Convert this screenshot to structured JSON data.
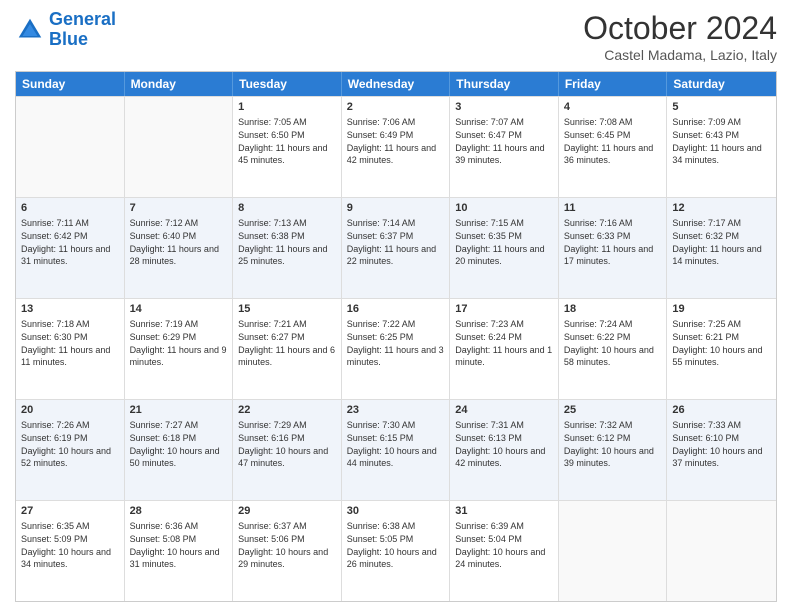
{
  "logo": {
    "line1": "General",
    "line2": "Blue"
  },
  "title": "October 2024",
  "subtitle": "Castel Madama, Lazio, Italy",
  "days": [
    "Sunday",
    "Monday",
    "Tuesday",
    "Wednesday",
    "Thursday",
    "Friday",
    "Saturday"
  ],
  "weeks": [
    [
      {
        "day": "",
        "text": ""
      },
      {
        "day": "",
        "text": ""
      },
      {
        "day": "1",
        "text": "Sunrise: 7:05 AM\nSunset: 6:50 PM\nDaylight: 11 hours and 45 minutes."
      },
      {
        "day": "2",
        "text": "Sunrise: 7:06 AM\nSunset: 6:49 PM\nDaylight: 11 hours and 42 minutes."
      },
      {
        "day": "3",
        "text": "Sunrise: 7:07 AM\nSunset: 6:47 PM\nDaylight: 11 hours and 39 minutes."
      },
      {
        "day": "4",
        "text": "Sunrise: 7:08 AM\nSunset: 6:45 PM\nDaylight: 11 hours and 36 minutes."
      },
      {
        "day": "5",
        "text": "Sunrise: 7:09 AM\nSunset: 6:43 PM\nDaylight: 11 hours and 34 minutes."
      }
    ],
    [
      {
        "day": "6",
        "text": "Sunrise: 7:11 AM\nSunset: 6:42 PM\nDaylight: 11 hours and 31 minutes."
      },
      {
        "day": "7",
        "text": "Sunrise: 7:12 AM\nSunset: 6:40 PM\nDaylight: 11 hours and 28 minutes."
      },
      {
        "day": "8",
        "text": "Sunrise: 7:13 AM\nSunset: 6:38 PM\nDaylight: 11 hours and 25 minutes."
      },
      {
        "day": "9",
        "text": "Sunrise: 7:14 AM\nSunset: 6:37 PM\nDaylight: 11 hours and 22 minutes."
      },
      {
        "day": "10",
        "text": "Sunrise: 7:15 AM\nSunset: 6:35 PM\nDaylight: 11 hours and 20 minutes."
      },
      {
        "day": "11",
        "text": "Sunrise: 7:16 AM\nSunset: 6:33 PM\nDaylight: 11 hours and 17 minutes."
      },
      {
        "day": "12",
        "text": "Sunrise: 7:17 AM\nSunset: 6:32 PM\nDaylight: 11 hours and 14 minutes."
      }
    ],
    [
      {
        "day": "13",
        "text": "Sunrise: 7:18 AM\nSunset: 6:30 PM\nDaylight: 11 hours and 11 minutes."
      },
      {
        "day": "14",
        "text": "Sunrise: 7:19 AM\nSunset: 6:29 PM\nDaylight: 11 hours and 9 minutes."
      },
      {
        "day": "15",
        "text": "Sunrise: 7:21 AM\nSunset: 6:27 PM\nDaylight: 11 hours and 6 minutes."
      },
      {
        "day": "16",
        "text": "Sunrise: 7:22 AM\nSunset: 6:25 PM\nDaylight: 11 hours and 3 minutes."
      },
      {
        "day": "17",
        "text": "Sunrise: 7:23 AM\nSunset: 6:24 PM\nDaylight: 11 hours and 1 minute."
      },
      {
        "day": "18",
        "text": "Sunrise: 7:24 AM\nSunset: 6:22 PM\nDaylight: 10 hours and 58 minutes."
      },
      {
        "day": "19",
        "text": "Sunrise: 7:25 AM\nSunset: 6:21 PM\nDaylight: 10 hours and 55 minutes."
      }
    ],
    [
      {
        "day": "20",
        "text": "Sunrise: 7:26 AM\nSunset: 6:19 PM\nDaylight: 10 hours and 52 minutes."
      },
      {
        "day": "21",
        "text": "Sunrise: 7:27 AM\nSunset: 6:18 PM\nDaylight: 10 hours and 50 minutes."
      },
      {
        "day": "22",
        "text": "Sunrise: 7:29 AM\nSunset: 6:16 PM\nDaylight: 10 hours and 47 minutes."
      },
      {
        "day": "23",
        "text": "Sunrise: 7:30 AM\nSunset: 6:15 PM\nDaylight: 10 hours and 44 minutes."
      },
      {
        "day": "24",
        "text": "Sunrise: 7:31 AM\nSunset: 6:13 PM\nDaylight: 10 hours and 42 minutes."
      },
      {
        "day": "25",
        "text": "Sunrise: 7:32 AM\nSunset: 6:12 PM\nDaylight: 10 hours and 39 minutes."
      },
      {
        "day": "26",
        "text": "Sunrise: 7:33 AM\nSunset: 6:10 PM\nDaylight: 10 hours and 37 minutes."
      }
    ],
    [
      {
        "day": "27",
        "text": "Sunrise: 6:35 AM\nSunset: 5:09 PM\nDaylight: 10 hours and 34 minutes."
      },
      {
        "day": "28",
        "text": "Sunrise: 6:36 AM\nSunset: 5:08 PM\nDaylight: 10 hours and 31 minutes."
      },
      {
        "day": "29",
        "text": "Sunrise: 6:37 AM\nSunset: 5:06 PM\nDaylight: 10 hours and 29 minutes."
      },
      {
        "day": "30",
        "text": "Sunrise: 6:38 AM\nSunset: 5:05 PM\nDaylight: 10 hours and 26 minutes."
      },
      {
        "day": "31",
        "text": "Sunrise: 6:39 AM\nSunset: 5:04 PM\nDaylight: 10 hours and 24 minutes."
      },
      {
        "day": "",
        "text": ""
      },
      {
        "day": "",
        "text": ""
      }
    ]
  ]
}
